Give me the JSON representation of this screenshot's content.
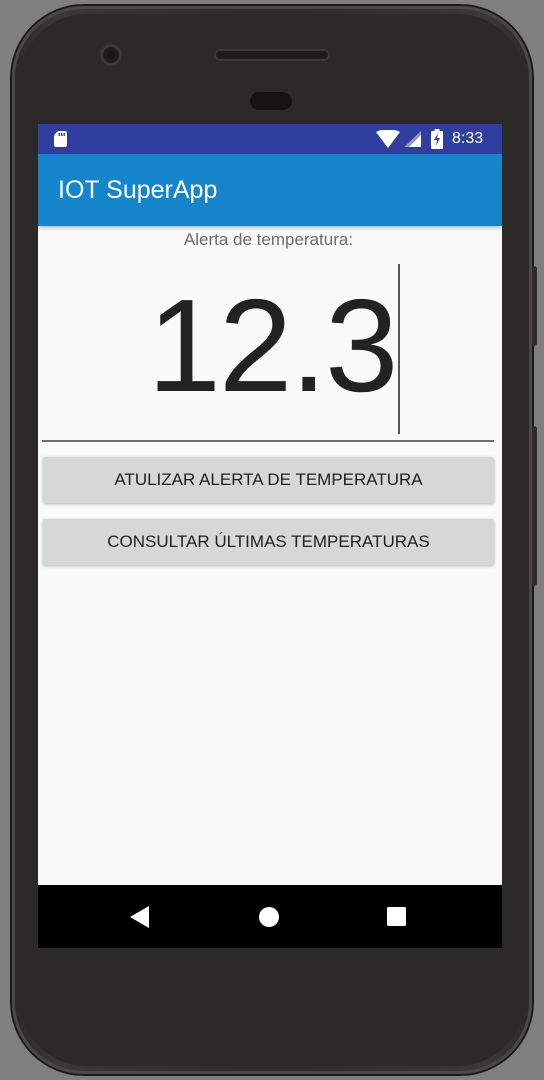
{
  "statusbar": {
    "time": "8:33",
    "icons": [
      "sd-card-icon",
      "wifi-icon",
      "signal-icon",
      "battery-charging-icon"
    ],
    "background_color": "#303f9f"
  },
  "appbar": {
    "title": "IOT SuperApp",
    "background_color": "#1585cc"
  },
  "main": {
    "alert_label": "Alerta de temperatura:",
    "temperature_value": "12.3",
    "update_button_label": "ATULIZAR ALERTA DE TEMPERATURA",
    "consult_button_label": "CONSULTAR ÚLTIMAS TEMPERATURAS"
  },
  "navbar": {
    "icons": [
      "back-icon",
      "home-icon",
      "recent-apps-icon"
    ]
  }
}
